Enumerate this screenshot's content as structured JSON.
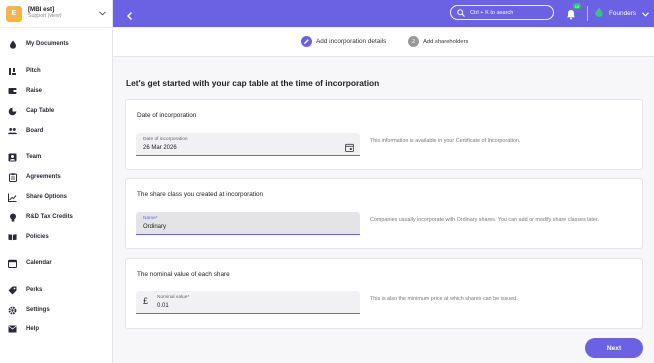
{
  "org": {
    "avatar_letter": "E",
    "name": "[MBI est]",
    "subtitle": "Support (view)"
  },
  "sidebar": {
    "items": [
      {
        "label": "My Documents",
        "icon": "drop-pin-icon"
      },
      {
        "label": "Pitch",
        "icon": "sliders-icon"
      },
      {
        "label": "Raise",
        "icon": "wallet-icon"
      },
      {
        "label": "Cap Table",
        "icon": "pie-chart-icon"
      },
      {
        "label": "Board",
        "icon": "people-icon"
      },
      {
        "label": "Team",
        "icon": "person-badge-icon"
      },
      {
        "label": "Agreements",
        "icon": "clipboard-icon"
      },
      {
        "label": "Share Options",
        "icon": "chart-icon"
      },
      {
        "label": "R&D Tax Credits",
        "icon": "bulb-icon"
      },
      {
        "label": "Policies",
        "icon": "book-icon"
      },
      {
        "label": "Calendar",
        "icon": "calendar-icon"
      },
      {
        "label": "Perks",
        "icon": "tag-icon"
      },
      {
        "label": "Settings",
        "icon": "gear-icon"
      },
      {
        "label": "Help",
        "icon": "mail-icon"
      }
    ]
  },
  "topbar": {
    "search_placeholder": "Ctrl + K to search",
    "notification_count": "10",
    "user_label": "Founders"
  },
  "stepper": {
    "steps": [
      {
        "number": "1",
        "label": "Add incorporation details",
        "state": "active"
      },
      {
        "number": "2",
        "label": "Add shareholders",
        "state": "pending"
      }
    ]
  },
  "main": {
    "title": "Let's get started with your cap table at the time of incorporation",
    "sections": [
      {
        "title": "Date of incorporation",
        "field_label": "Date of incorporation",
        "field_value": "26 Mar 2026",
        "hint": "This information is available in your Certificate of Incorporation."
      },
      {
        "title": "The share class you created at incorporation",
        "field_label": "Name*",
        "field_value": "Ordinary",
        "hint": "Companies usually incorporate with Ordinary shares. You can add or modify share classes later."
      },
      {
        "title": "The nominal value of each share",
        "field_prefix": "£",
        "field_label": "Nominal value*",
        "field_value": "0.01",
        "hint": "This is also the minimum price at which shares can be issued."
      }
    ],
    "next_label": "Next"
  },
  "colors": {
    "accent": "#6b62e3",
    "org_avatar": "#f1b64a",
    "badge": "#2cc46a"
  }
}
